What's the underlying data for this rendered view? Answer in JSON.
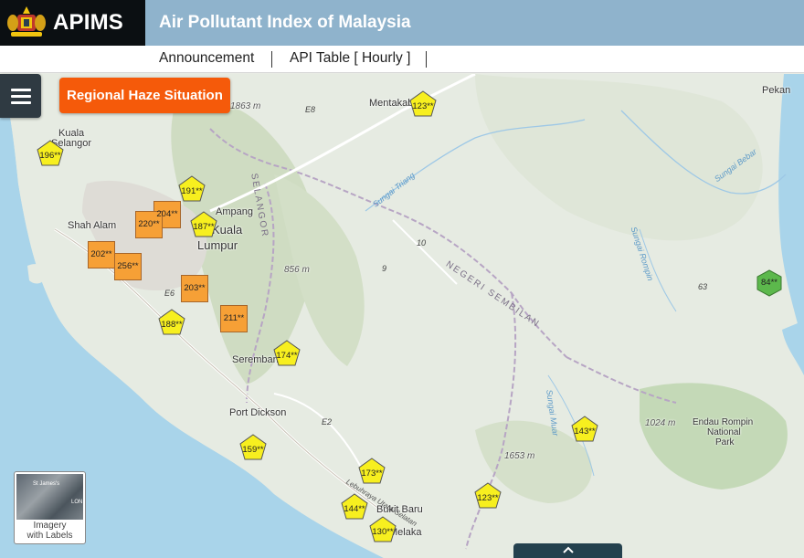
{
  "header": {
    "brand": "APIMS",
    "title": "Air Pollutant Index of Malaysia"
  },
  "nav": {
    "items": [
      {
        "label": "Announcement"
      },
      {
        "label": "API Table [ Hourly ]"
      }
    ]
  },
  "toolbar": {
    "menu_icon": "hamburger-menu-icon",
    "haze_button": "Regional Haze Situation"
  },
  "map": {
    "places": {
      "kuala_selangor_1": "Kuala",
      "kuala_selangor_2": "Selangor",
      "shah_alam": "Shah Alam",
      "ampang": "Ampang",
      "kuala_lumpur_1": "Kuala",
      "kuala_lumpur_2": "Lumpur",
      "mentakab": "Mentakab",
      "pekan": "Pekan",
      "seremban": "Seremban",
      "port_dickson": "Port Dickson",
      "bukit_baru": "Bukit Baru",
      "melaka": "Melaka",
      "endau_rompin_1": "Endau Rompin",
      "endau_rompin_2": "National",
      "endau_rompin_3": "Park",
      "alor_gajah": "Lebuhraya Utara-Selatan"
    },
    "regions": {
      "selangor": "SELANGOR",
      "negeri_sembilan": "NEGERI SEMBILAN"
    },
    "rivers": {
      "triang": "Sungai Triang",
      "bebar": "Sungai Bebar",
      "rompin": "Sungai Rompin",
      "muar": "Sungai Muar"
    },
    "roads": {
      "e8": "E8",
      "e6": "E6",
      "e2": "E2",
      "r63": "63",
      "r9": "9",
      "r10": "10"
    },
    "elevations": {
      "e1863": "1863 m",
      "e856": "856 m",
      "e1653": "1653 m",
      "e1024": "1024 m"
    },
    "readings": [
      {
        "id": "r196",
        "label": "196**",
        "level": "unhealthy"
      },
      {
        "id": "r191",
        "label": "191**",
        "level": "unhealthy"
      },
      {
        "id": "r204",
        "label": "204**",
        "level": "very-unhealthy"
      },
      {
        "id": "r220",
        "label": "220**",
        "level": "very-unhealthy"
      },
      {
        "id": "r187",
        "label": "187**",
        "level": "unhealthy"
      },
      {
        "id": "r202",
        "label": "202**",
        "level": "very-unhealthy"
      },
      {
        "id": "r256",
        "label": "256**",
        "level": "very-unhealthy"
      },
      {
        "id": "r203",
        "label": "203**",
        "level": "very-unhealthy"
      },
      {
        "id": "r188",
        "label": "188**",
        "level": "unhealthy"
      },
      {
        "id": "r211",
        "label": "211**",
        "level": "very-unhealthy"
      },
      {
        "id": "r174",
        "label": "174**",
        "level": "unhealthy"
      },
      {
        "id": "r123a",
        "label": "123**",
        "level": "unhealthy"
      },
      {
        "id": "r84",
        "label": "84**",
        "level": "moderate"
      },
      {
        "id": "r143",
        "label": "143**",
        "level": "unhealthy"
      },
      {
        "id": "r159",
        "label": "159**",
        "level": "unhealthy"
      },
      {
        "id": "r173",
        "label": "173**",
        "level": "unhealthy"
      },
      {
        "id": "r123b",
        "label": "123**",
        "level": "unhealthy"
      },
      {
        "id": "r144",
        "label": "144**",
        "level": "unhealthy"
      },
      {
        "id": "r130",
        "label": "130**",
        "level": "unhealthy"
      }
    ],
    "colors": {
      "unhealthy": "#f7ef1f",
      "very_unhealthy": "#f6a036",
      "moderate": "#5cb84c",
      "sea": "#a9d4ea"
    }
  },
  "basemap": {
    "label_1": "Imagery",
    "label_2": "with Labels",
    "thumb_1": "St James's",
    "thumb_2": "LON"
  },
  "bottom_tab": {
    "icon": "chevron-up-icon"
  }
}
